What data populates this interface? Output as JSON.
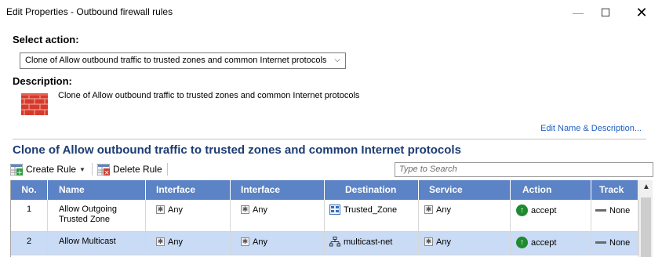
{
  "window": {
    "title": "Edit Properties - Outbound firewall rules",
    "minimize": "—",
    "maximize": "☐",
    "close": "✕"
  },
  "select_action": {
    "label": "Select action:",
    "value": "Clone of Allow outbound traffic to trusted zones and common Internet protocols",
    "chevron": "⌵"
  },
  "description": {
    "label": "Description:",
    "icon": "firewall-brick-icon",
    "text": "Clone of Allow outbound traffic to trusted zones and common Internet protocols",
    "edit_link": "Edit Name & Description..."
  },
  "rule_title": "Clone of Allow outbound traffic to trusted zones and common Internet protocols",
  "toolbar": {
    "create_rule": "Create Rule",
    "delete_rule": "Delete Rule",
    "search_placeholder": "Type to Search"
  },
  "table": {
    "columns": [
      "No.",
      "Name",
      "Interface",
      "Interface",
      "Destination",
      "Service",
      "Action",
      "Track"
    ],
    "rows": [
      {
        "no": "1",
        "name": "Allow Outgoing Trusted Zone",
        "interface_src": "Any",
        "interface_dst": "Any",
        "destination": "Trusted_Zone",
        "service": "Any",
        "action": "accept",
        "track": "None",
        "selected": false
      },
      {
        "no": "2",
        "name": "Allow Multicast",
        "interface_src": "Any",
        "interface_dst": "Any",
        "destination": "multicast-net",
        "service": "Any",
        "action": "accept",
        "track": "None",
        "selected": true
      }
    ]
  },
  "colors": {
    "header_bg": "#5b83c5",
    "selected_row": "#c9dbf5",
    "title_blue": "#1d3c73",
    "link_blue": "#1f5fbf",
    "accept_green": "#1f8a2e",
    "brick_red": "#d63a2c"
  }
}
